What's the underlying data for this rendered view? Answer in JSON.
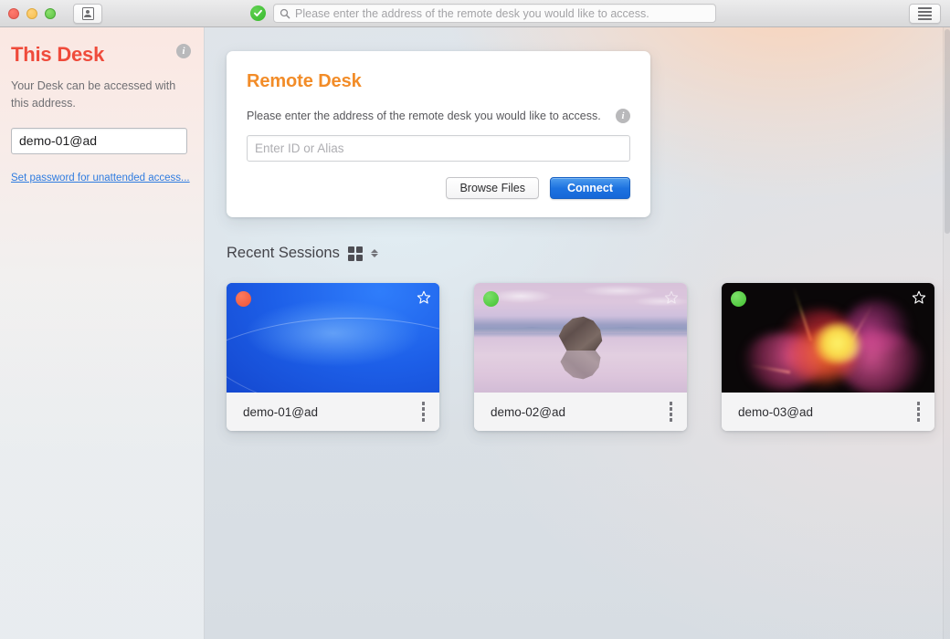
{
  "window": {
    "traffic_lights": [
      "close",
      "minimize",
      "zoom"
    ],
    "contact_button_icon": "person-card-icon",
    "menu_button_icon": "hamburger-icon",
    "connection_status_icon": "green-check-icon",
    "search": {
      "icon": "search-icon",
      "placeholder": "Please enter the address of the remote desk you would like to access.",
      "value": ""
    }
  },
  "sidebar": {
    "title": "This Desk",
    "info_icon": "info-icon",
    "description": "Your Desk can be accessed with this address.",
    "address_value": "demo-01@ad",
    "password_link": "Set password for unattended access...",
    "accent_color": "#ef4b3b"
  },
  "remote_desk": {
    "title": "Remote Desk",
    "title_color": "#f28c28",
    "subtitle": "Please enter the address of the remote desk you would like to access.",
    "info_icon": "info-icon",
    "input_placeholder": "Enter ID or Alias",
    "input_value": "",
    "browse_label": "Browse Files",
    "connect_label": "Connect",
    "connect_color": "#1d72e0"
  },
  "recent_sessions": {
    "title": "Recent Sessions",
    "view_icon": "grid-view-icon",
    "sort_icon": "stepper-chevron-icon",
    "cards": [
      {
        "name": "demo-01@ad",
        "status": "offline",
        "status_color": "#ef5338",
        "favorite": false,
        "star_icon": "star-outline-icon",
        "menu_icon": "more-options-icon",
        "thumbnail": "blue-gradient-wallpaper"
      },
      {
        "name": "demo-02@ad",
        "status": "online",
        "status_color": "#43c130",
        "favorite": false,
        "star_icon": "star-outline-icon",
        "menu_icon": "more-options-icon",
        "thumbnail": "lake-rock-wallpaper"
      },
      {
        "name": "demo-03@ad",
        "status": "online",
        "status_color": "#43c130",
        "favorite": false,
        "star_icon": "star-outline-icon",
        "menu_icon": "more-options-icon",
        "thumbnail": "powder-explosion-wallpaper"
      }
    ]
  }
}
